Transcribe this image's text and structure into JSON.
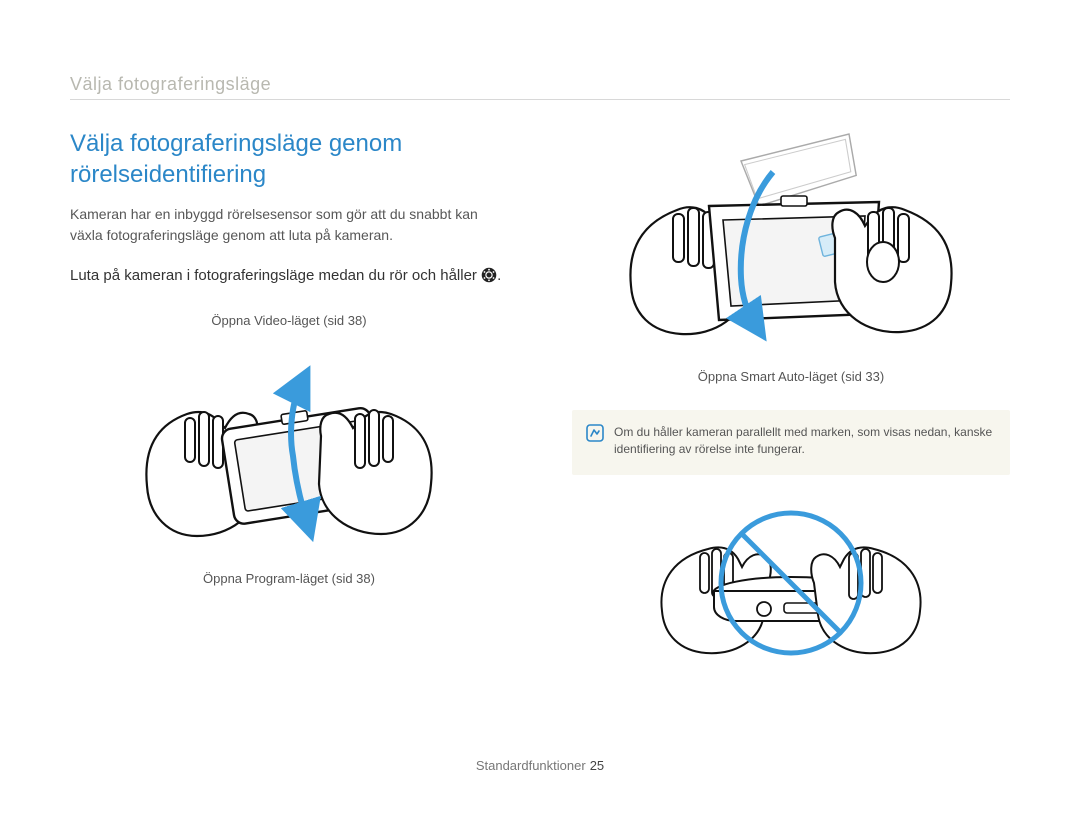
{
  "breadcrumb": "Välja fotograferingsläge",
  "heading": "Välja fotograferingsläge genom rörelseidentifiering",
  "body": "Kameran har en inbyggd rörelsesensor som gör att du snabbt kan växla fotograferingsläge genom att luta på kameran.",
  "instruction_pre": "Luta på kameran i fotograferingsläge medan du rör och håller ",
  "instruction_post": ".",
  "left": {
    "caption_top": "Öppna Video-läget (sid 38)",
    "caption_bottom": "Öppna Program-läget (sid 38)"
  },
  "right": {
    "caption": "Öppna Smart Auto-läget (sid 33)"
  },
  "note": "Om du håller kameran parallellt med marken, som visas nedan, kanske identifiering av rörelse inte fungerar.",
  "footer_label": "Standardfunktioner",
  "footer_page": "25",
  "icons": {
    "mode_button": "mode-dial-icon",
    "note": "note-icon"
  }
}
